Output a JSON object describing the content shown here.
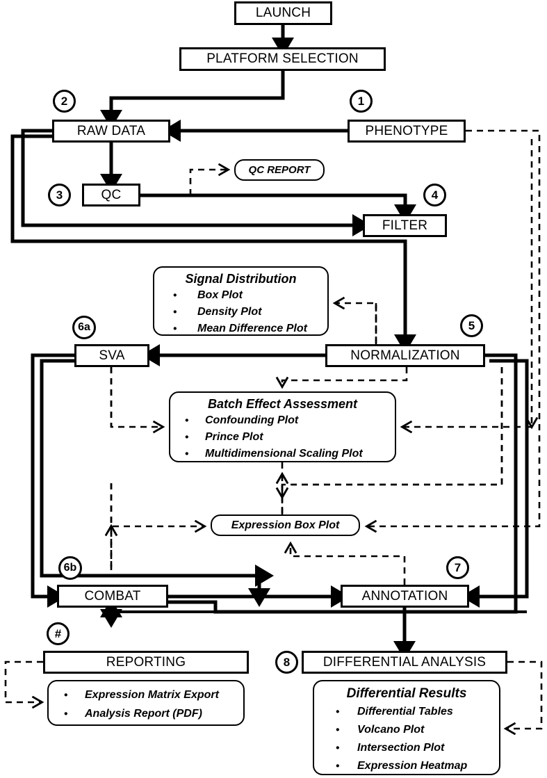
{
  "diagram": {
    "title": "Microarray analysis pipeline flowchart",
    "colors": {
      "line": "#000000",
      "fill": "#ffffff",
      "text": "#000000"
    }
  },
  "nodes": {
    "launch": {
      "label": "LAUNCH"
    },
    "platform": {
      "label": "PLATFORM SELECTION"
    },
    "raw_data": {
      "label": "RAW DATA"
    },
    "phenotype": {
      "label": "PHENOTYPE"
    },
    "qc": {
      "label": "QC"
    },
    "filter": {
      "label": "FILTER"
    },
    "sva": {
      "label": "SVA"
    },
    "normalization": {
      "label": "NORMALIZATION"
    },
    "combat": {
      "label": "COMBAT"
    },
    "annotation": {
      "label": "ANNOTATION"
    },
    "reporting": {
      "label": "REPORTING"
    },
    "differential_analysis": {
      "label": "DIFFERENTIAL ANALYSIS"
    }
  },
  "panels": {
    "qc_report": {
      "title": "QC REPORT",
      "items": []
    },
    "signal_distribution": {
      "title": "Signal Distribution",
      "items": [
        "Box Plot",
        "Density Plot",
        "Mean Difference Plot"
      ]
    },
    "batch_effect": {
      "title": "Batch Effect Assessment",
      "items": [
        "Confounding Plot",
        "Prince Plot",
        "Multidimensional Scaling Plot"
      ]
    },
    "expression_box_plot": {
      "title": "Expression Box Plot",
      "items": []
    },
    "reporting_outputs": {
      "title": "",
      "items": [
        "Expression Matrix Export",
        "Analysis Report (PDF)"
      ]
    },
    "differential_results": {
      "title": "Differential Results",
      "items": [
        "Differential Tables",
        "Volcano Plot",
        "Intersection Plot",
        "Expression Heatmap"
      ]
    }
  },
  "step_markers": [
    {
      "id": "marker-1",
      "label": "1"
    },
    {
      "id": "marker-2",
      "label": "2"
    },
    {
      "id": "marker-3",
      "label": "3"
    },
    {
      "id": "marker-4",
      "label": "4"
    },
    {
      "id": "marker-5",
      "label": "5"
    },
    {
      "id": "marker-6a",
      "label": "6a"
    },
    {
      "id": "marker-6b",
      "label": "6b"
    },
    {
      "id": "marker-7",
      "label": "7"
    },
    {
      "id": "marker-8",
      "label": "8"
    },
    {
      "id": "marker-hash",
      "label": "#"
    }
  ]
}
